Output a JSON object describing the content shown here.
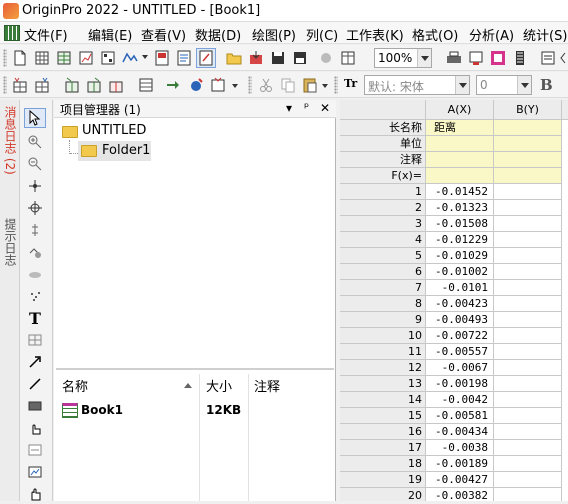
{
  "window": {
    "title": "OriginPro 2022 - UNTITLED - [Book1]"
  },
  "menu": [
    "文件(F)",
    "编辑(E)",
    "查看(V)",
    "数据(D)",
    "绘图(P)",
    "列(C)",
    "工作表(K)",
    "格式(O)",
    "分析(A)",
    "统计(S)"
  ],
  "toolbar": {
    "zoom": "100%",
    "font_name": "默认: 宋体",
    "font_size": "0",
    "bold_label": "B"
  },
  "side_tabs": {
    "messages": "消息日志 (2)",
    "hints": "提示日志"
  },
  "project_manager": {
    "title": "项目管理器 (1)",
    "controls": {
      "dropdown": "▾",
      "pin": "ᵖ",
      "close": "✕"
    },
    "tree": {
      "root": "UNTITLED",
      "folder": "Folder1"
    },
    "list_headers": {
      "name": "名称",
      "size": "大小",
      "comment": "注释"
    },
    "items": [
      {
        "name": "Book1",
        "size": "12KB",
        "comment": ""
      }
    ]
  },
  "sheet": {
    "columns": [
      "A(X)",
      "B(Y)"
    ],
    "meta_rows": [
      {
        "label": "长名称",
        "a": "距离",
        "b": ""
      },
      {
        "label": "单位",
        "a": "",
        "b": ""
      },
      {
        "label": "注释",
        "a": "",
        "b": ""
      },
      {
        "label": "F(x)=",
        "a": "",
        "b": ""
      }
    ],
    "rows": [
      {
        "n": "1",
        "a": "-0.01452",
        "b": ""
      },
      {
        "n": "2",
        "a": "-0.01323",
        "b": ""
      },
      {
        "n": "3",
        "a": "-0.01508",
        "b": ""
      },
      {
        "n": "4",
        "a": "-0.01229",
        "b": ""
      },
      {
        "n": "5",
        "a": "-0.01029",
        "b": ""
      },
      {
        "n": "6",
        "a": "-0.01002",
        "b": ""
      },
      {
        "n": "7",
        "a": "-0.0101",
        "b": ""
      },
      {
        "n": "8",
        "a": "-0.00423",
        "b": ""
      },
      {
        "n": "9",
        "a": "-0.00493",
        "b": ""
      },
      {
        "n": "10",
        "a": "-0.00722",
        "b": ""
      },
      {
        "n": "11",
        "a": "-0.00557",
        "b": ""
      },
      {
        "n": "12",
        "a": "-0.0067",
        "b": ""
      },
      {
        "n": "13",
        "a": "-0.00198",
        "b": ""
      },
      {
        "n": "14",
        "a": "-0.0042",
        "b": ""
      },
      {
        "n": "15",
        "a": "-0.00581",
        "b": ""
      },
      {
        "n": "16",
        "a": "-0.00434",
        "b": ""
      },
      {
        "n": "17",
        "a": "-0.0038",
        "b": ""
      },
      {
        "n": "18",
        "a": "-0.00189",
        "b": ""
      },
      {
        "n": "19",
        "a": "-0.00427",
        "b": ""
      },
      {
        "n": "20",
        "a": "-0.00382",
        "b": ""
      }
    ]
  },
  "colors": {
    "meta_row_bg": "#fbf8c8",
    "header_bg": "#ececec",
    "selected_bg": "#e5e5e5",
    "message_tab_text": "#d33a2c"
  }
}
